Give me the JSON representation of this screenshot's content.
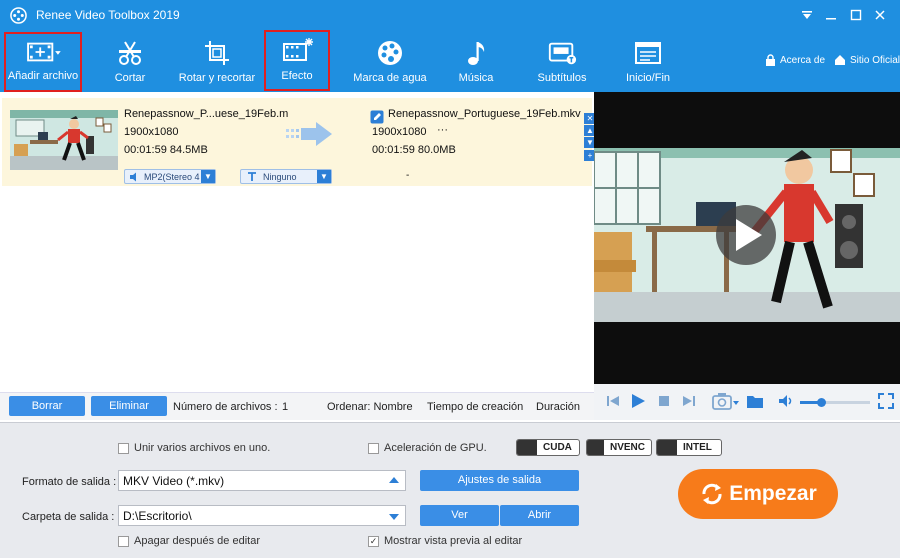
{
  "app": {
    "title": "Renee Video Toolbox 2019"
  },
  "toolbar": {
    "items": [
      {
        "label": "Añadir archivo",
        "icon": "film-add-icon"
      },
      {
        "label": "Cortar",
        "icon": "scissors-icon"
      },
      {
        "label": "Rotar y recortar",
        "icon": "crop-rotate-icon"
      },
      {
        "label": "Efecto",
        "icon": "film-effect-icon"
      },
      {
        "label": "Marca de agua",
        "icon": "palette-icon"
      },
      {
        "label": "Música",
        "icon": "music-note-icon"
      },
      {
        "label": "Subtítulos",
        "icon": "subtitles-icon"
      },
      {
        "label": "Inicio/Fin",
        "icon": "intro-outro-icon"
      }
    ],
    "about_label": "Acerca de",
    "site_label": "Sitio Oficial"
  },
  "file": {
    "source_name": "Renepassnow_P...uese_19Feb.m",
    "source_resolution": "1900x1080",
    "source_duration_size": "00:01:59  84.5MB",
    "output_name": "Renepassnow_Portuguese_19Feb.mkv",
    "output_resolution": "1900x1080",
    "output_more": "···",
    "output_duration_size": "00:01:59  80.0MB",
    "audio_track": "MP2(Stereo 4",
    "subtitle": "Ninguno",
    "subtitle_output": "-"
  },
  "listbar": {
    "clear_label": "Borrar",
    "delete_label": "Eliminar",
    "count_label": "Número de archivos :",
    "count_value": "1",
    "sort_label": "Ordenar: Nombre",
    "sort_creation": "Tiempo de creación",
    "sort_duration": "Duración"
  },
  "player": {
    "volume": 0.3
  },
  "settings": {
    "merge_label": "Unir varios archivos en uno.",
    "merge_checked": false,
    "gpu_label": "Aceleración de GPU.",
    "gpu_checked": false,
    "gpu_options": [
      "CUDA",
      "NVENC",
      "INTEL"
    ],
    "format_label": "Formato de salida :",
    "format_value": "MKV Video (*.mkv)",
    "output_settings_label": "Ajustes de salida",
    "folder_label": "Carpeta de salida :",
    "folder_value": "D:\\Escritorio\\",
    "view_label": "Ver",
    "open_label": "Abrir",
    "shutdown_label": "Apagar después de editar",
    "shutdown_checked": false,
    "preview_label": "Mostrar vista previa al editar",
    "preview_checked": true,
    "start_label": "Empezar"
  },
  "colors": {
    "accent": "#1f8fe0",
    "start": "#f77b1a",
    "highlight": "#e02020",
    "row": "#fdf6dc"
  }
}
